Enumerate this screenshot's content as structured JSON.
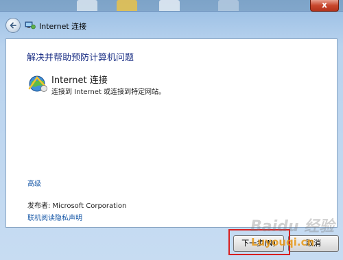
{
  "window": {
    "title": "Internet 连接",
    "close_label": "x"
  },
  "content": {
    "heading": "解决并帮助预防计算机问题",
    "item": {
      "title": "Internet 连接",
      "description": "连接到 Internet 或连接到特定网站。"
    },
    "advanced_link": "高级",
    "publisher": "发布者: Microsoft Corporation",
    "privacy_link": "联机阅读隐私声明"
  },
  "buttons": {
    "next": "下一步(N)",
    "cancel": "取消"
  },
  "watermarks": {
    "baidu": "Baidu 经验",
    "site": "Luyouqi.cn"
  },
  "icons": {
    "back": "back-arrow-icon",
    "title": "network-troubleshoot-icon",
    "item": "internet-globe-icon"
  }
}
